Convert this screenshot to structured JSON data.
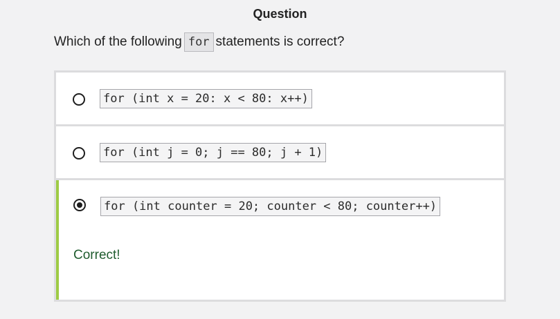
{
  "header": {
    "title": "Question"
  },
  "question": {
    "prefix": "Which of the following",
    "code": "for",
    "suffix": "statements is correct?"
  },
  "options": [
    {
      "code": "for (int x = 20: x < 80: x++)",
      "selected": false
    },
    {
      "code": "for (int j = 0; j == 80; j + 1)",
      "selected": false
    },
    {
      "code": "for (int counter = 20; counter < 80; counter++)",
      "selected": true
    }
  ],
  "feedback": {
    "text": "Correct!",
    "color": "#1f5c2e"
  },
  "colors": {
    "correct_accent": "#9ecb44",
    "page_background": "#f2f2f3"
  }
}
